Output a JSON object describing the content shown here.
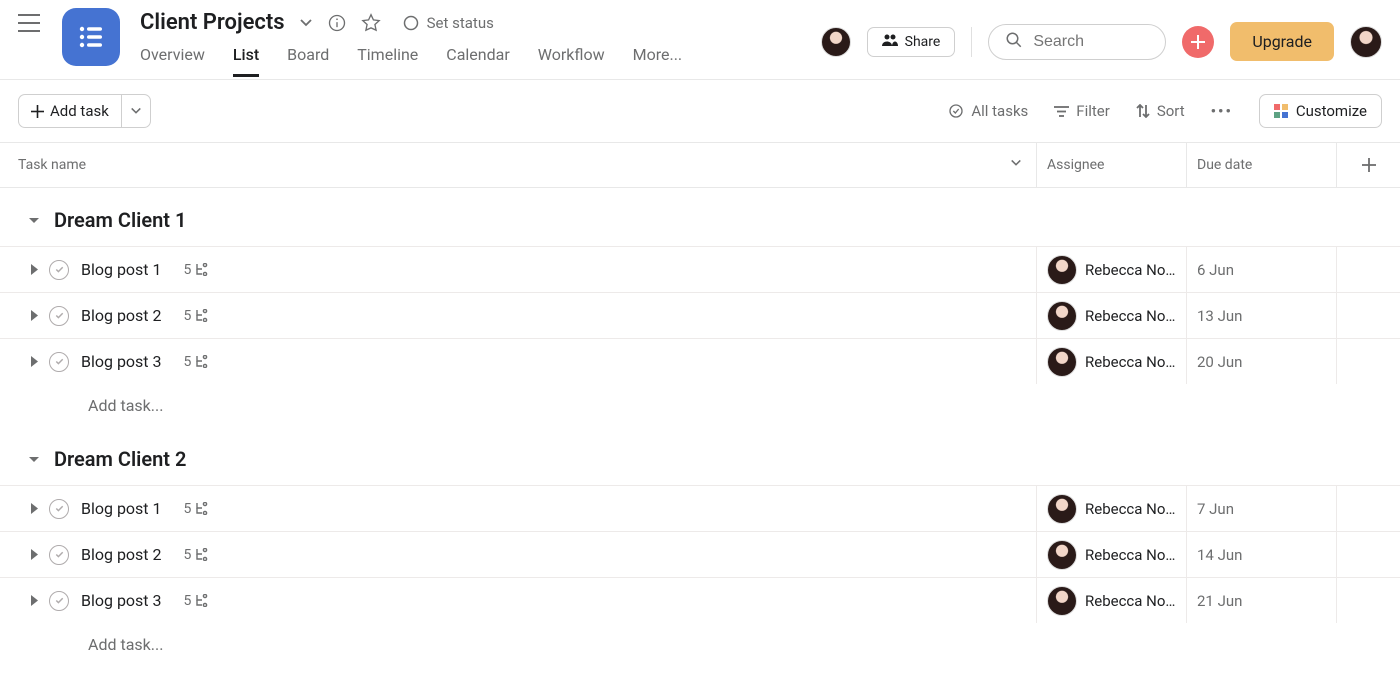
{
  "header": {
    "project_title": "Client Projects",
    "set_status": "Set status",
    "share_label": "Share",
    "search_placeholder": "Search",
    "upgrade_label": "Upgrade",
    "tabs": [
      "Overview",
      "List",
      "Board",
      "Timeline",
      "Calendar",
      "Workflow",
      "More..."
    ],
    "active_tab": "List"
  },
  "toolbar": {
    "add_task": "Add task",
    "all_tasks": "All tasks",
    "filter": "Filter",
    "sort": "Sort",
    "customize": "Customize"
  },
  "columns": {
    "task_name": "Task name",
    "assignee": "Assignee",
    "due_date": "Due date"
  },
  "sections": [
    {
      "name": "Dream Client 1",
      "tasks": [
        {
          "name": "Blog post 1",
          "subtasks": 5,
          "assignee": "Rebecca No...",
          "due": "6 Jun"
        },
        {
          "name": "Blog post 2",
          "subtasks": 5,
          "assignee": "Rebecca No...",
          "due": "13 Jun"
        },
        {
          "name": "Blog post 3",
          "subtasks": 5,
          "assignee": "Rebecca No...",
          "due": "20 Jun"
        }
      ],
      "add_task_placeholder": "Add task..."
    },
    {
      "name": "Dream Client 2",
      "tasks": [
        {
          "name": "Blog post 1",
          "subtasks": 5,
          "assignee": "Rebecca No...",
          "due": "7 Jun"
        },
        {
          "name": "Blog post 2",
          "subtasks": 5,
          "assignee": "Rebecca No...",
          "due": "14 Jun"
        },
        {
          "name": "Blog post 3",
          "subtasks": 5,
          "assignee": "Rebecca No...",
          "due": "21 Jun"
        }
      ],
      "add_task_placeholder": "Add task..."
    }
  ]
}
